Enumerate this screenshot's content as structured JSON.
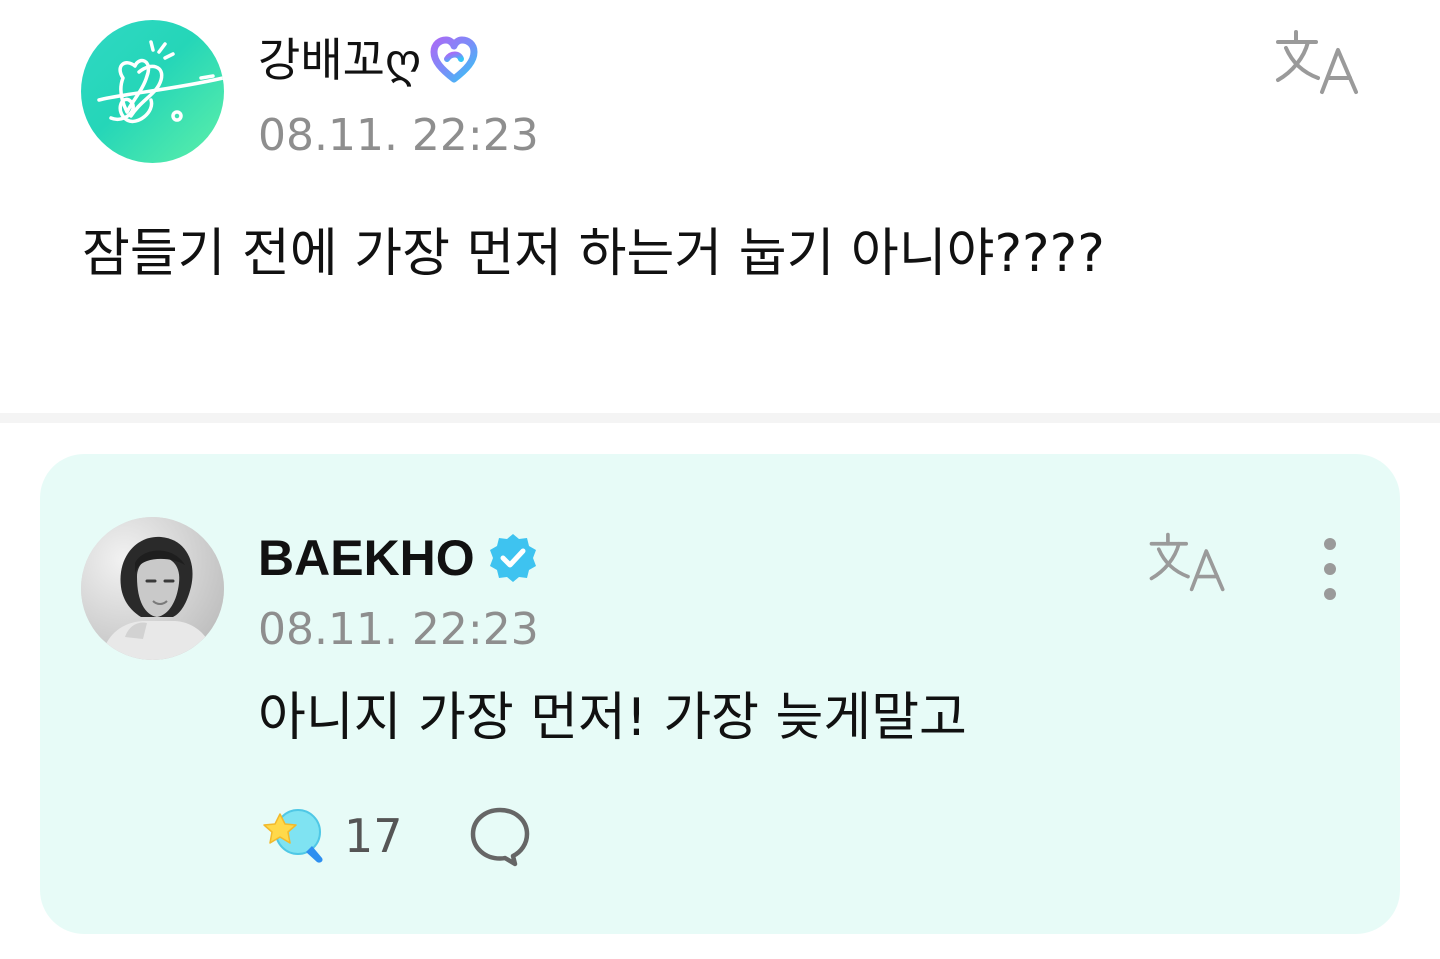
{
  "post": {
    "author_name": "강배꼬ღ",
    "timestamp": "08.11. 22:23",
    "body": "잠들기 전에 가장 먼저 하는거 눕기 아니야????",
    "avatar_icon": "heart-doodle-avatar",
    "badge_icon": "membership-heart-badge-icon",
    "translate_icon": "translate-icon"
  },
  "reply": {
    "author_name": "BAEKHO",
    "timestamp": "08.11. 22:23",
    "body": "아니지 가장 먼저! 가장 늦게말고",
    "like_count": "17",
    "verified_icon": "verified-badge-icon",
    "translate_icon": "translate-icon",
    "more_icon": "more-vertical-icon",
    "like_icon": "star-lightstick-icon",
    "comment_icon": "comment-bubble-icon"
  },
  "colors": {
    "reply_background": "#e7fbf7",
    "timestamp_gray": "#8e8e8e",
    "verified_blue": "#3ec3f0",
    "fan_avatar_teal": "#2fd8c4",
    "divider": "#f4f4f4"
  }
}
